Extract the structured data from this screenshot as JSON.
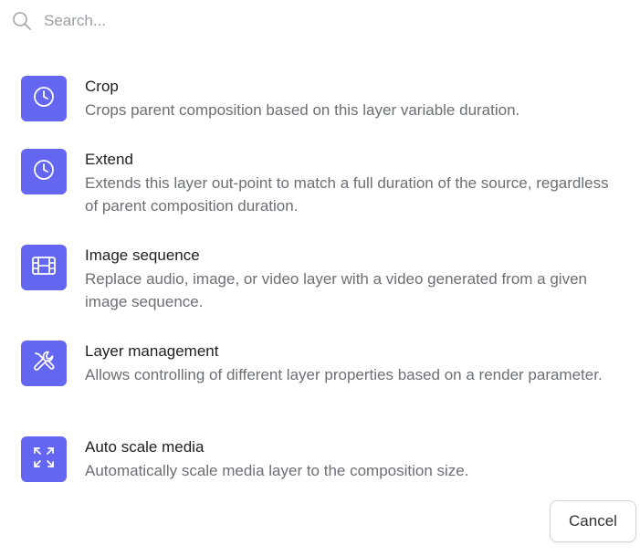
{
  "colors": {
    "accent": "#6366f1",
    "icon_fg": "#ffffff",
    "text_primary": "#1f1f1f",
    "text_secondary": "#6b6f76"
  },
  "search": {
    "placeholder": "Search...",
    "value": "",
    "icon": "search-icon"
  },
  "items": [
    {
      "icon": "clock-icon",
      "title": "Crop",
      "description": "Crops parent composition based on this layer variable duration."
    },
    {
      "icon": "clock-icon",
      "title": "Extend",
      "description": "Extends this layer out-point to match a full duration of the source, regardless of parent composition duration."
    },
    {
      "icon": "film-icon",
      "title": "Image sequence",
      "description": "Replace audio, image, or video layer with a video generated from a given image sequence."
    },
    {
      "icon": "tools-icon",
      "title": "Layer management",
      "description": "Allows controlling of different layer properties based on a render parameter."
    },
    {
      "icon": "expand-icon",
      "title": "Auto scale media",
      "description": "Automatically scale media layer to the composition size."
    }
  ],
  "footer": {
    "cancel_label": "Cancel"
  }
}
